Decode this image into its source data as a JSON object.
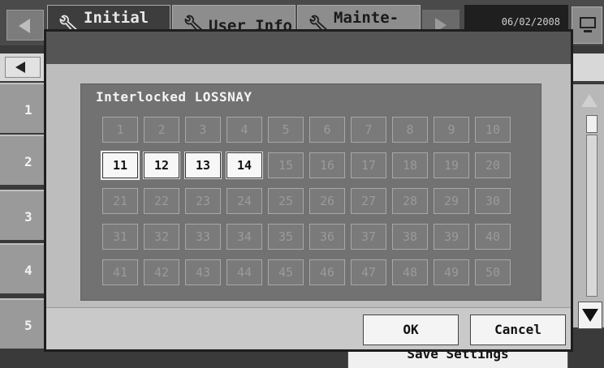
{
  "header": {
    "tabs": [
      {
        "label": "Initial"
      },
      {
        "label": "User Info"
      },
      {
        "label": "Mainte-"
      }
    ],
    "date": "06/02/2008"
  },
  "rows": [
    "1",
    "2",
    "3",
    "4",
    "5"
  ],
  "footer": {
    "save_label": "Save Settings"
  },
  "dialog": {
    "panel_title": "Interlocked LOSSNAY",
    "cells": [
      "1",
      "2",
      "3",
      "4",
      "5",
      "6",
      "7",
      "8",
      "9",
      "10",
      "11",
      "12",
      "13",
      "14",
      "15",
      "16",
      "17",
      "18",
      "19",
      "20",
      "21",
      "22",
      "23",
      "24",
      "25",
      "26",
      "27",
      "28",
      "29",
      "30",
      "31",
      "32",
      "33",
      "34",
      "35",
      "36",
      "37",
      "38",
      "39",
      "40",
      "41",
      "42",
      "43",
      "44",
      "45",
      "46",
      "47",
      "48",
      "49",
      "50"
    ],
    "selected": [
      "11",
      "12",
      "13",
      "14"
    ],
    "focused": "11",
    "ok_label": "OK",
    "cancel_label": "Cancel"
  },
  "colors": {
    "dialog_title_bar": "#555555",
    "panel": "#727272",
    "selected_cell": "#f7f7f7"
  },
  "icons": [
    "wrench-icon",
    "monitor-icon",
    "arrow-left-icon",
    "arrow-right-icon",
    "scroll-up-icon",
    "scroll-down-icon"
  ]
}
